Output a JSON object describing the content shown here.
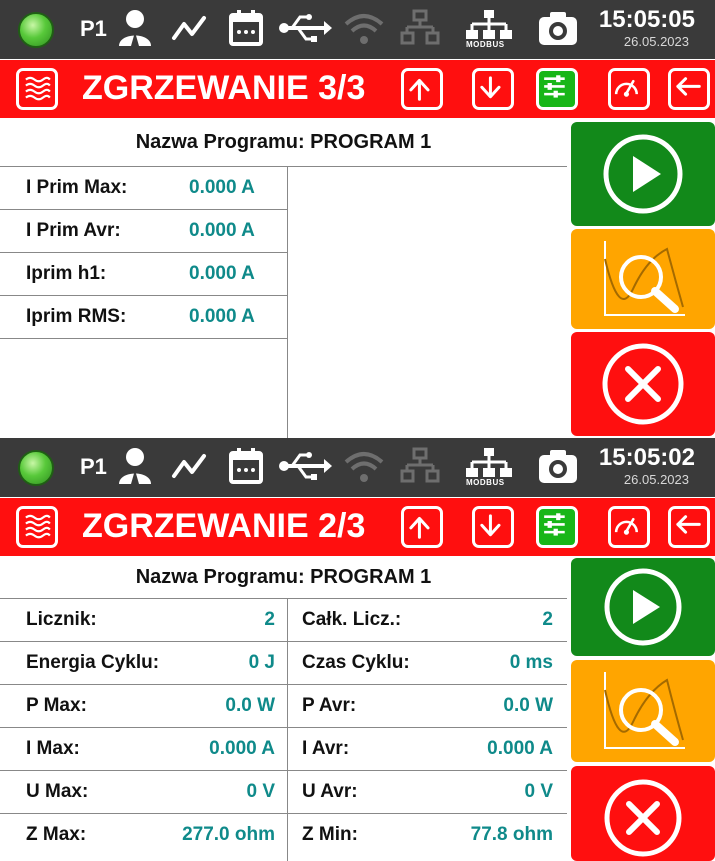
{
  "screens": [
    {
      "status": {
        "profile": "P1",
        "time": "15:05:05",
        "date": "26.05.2023",
        "modbus": "MODBUS"
      },
      "title": "ZGRZEWANIE 3/3",
      "program_name": "Nazwa Programu: PROGRAM 1",
      "rows": [
        {
          "label": "I Prim Max:",
          "value": "0.000 A"
        },
        {
          "label": "I Prim Avr:",
          "value": "0.000 A"
        },
        {
          "label": "Iprim h1:",
          "value": "0.000 A"
        },
        {
          "label": "Iprim RMS:",
          "value": "0.000 A"
        }
      ]
    },
    {
      "status": {
        "profile": "P1",
        "time": "15:05:02",
        "date": "26.05.2023",
        "modbus": "MODBUS"
      },
      "title": "ZGRZEWANIE 2/3",
      "program_name": "Nazwa Programu: PROGRAM 1",
      "rows": [
        {
          "label": "Licznik:",
          "value": "2",
          "label2": "Całk. Licz.:",
          "value2": "2"
        },
        {
          "label": "Energia Cyklu:",
          "value": "0 J",
          "label2": "Czas Cyklu:",
          "value2": "0 ms"
        },
        {
          "label": "P Max:",
          "value": "0.0 W",
          "label2": "P Avr:",
          "value2": "0.0 W"
        },
        {
          "label": "I Max:",
          "value": "0.000 A",
          "label2": "I Avr:",
          "value2": "0.000 A"
        },
        {
          "label": "U Max:",
          "value": "0 V",
          "label2": "U Avr:",
          "value2": "0 V"
        },
        {
          "label": "Z Max:",
          "value": "277.0 ohm",
          "label2": "Z Min:",
          "value2": "77.8 ohm"
        }
      ]
    }
  ],
  "icons": {
    "status": [
      "status-led-icon",
      "user-icon",
      "trend-icon",
      "calendar-icon",
      "usb-icon",
      "wifi-icon",
      "network-icon",
      "modbus-icon",
      "camera-icon"
    ],
    "title": [
      "heating-icon",
      "arrow-up-icon",
      "arrow-down-icon",
      "settings-sliders-icon",
      "gauge-icon",
      "back-arrow-icon"
    ],
    "side": [
      "play-icon",
      "chart-zoom-icon",
      "cancel-icon"
    ]
  },
  "colors": {
    "status_bar": "#3a3a3a",
    "title_bar": "#ff0f0f",
    "value_text": "#0f8a8a",
    "start_button": "#12891a",
    "analysis_button": "#ffa500",
    "cancel_button": "#ff0f0f",
    "led_on": "#58c93a"
  }
}
